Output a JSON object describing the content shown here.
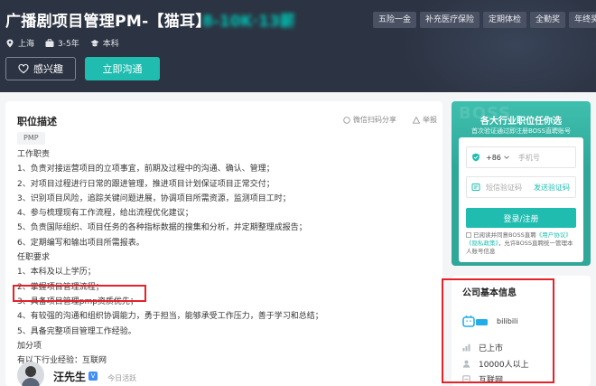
{
  "header": {
    "job_title": "广播剧项目管理PM-【猫耳】",
    "salary": "8-10K·13薪",
    "meta": {
      "city": "上海",
      "experience": "3-5年",
      "education": "本科"
    },
    "benefit_tags": [
      "五险一金",
      "补充医疗保险",
      "定期体检",
      "全勤奖",
      "年终奖"
    ],
    "interest_label": "感兴趣",
    "chat_label": "立即沟通"
  },
  "job": {
    "section_title": "职位描述",
    "share_label": "微信扫码分享",
    "report_label": "举报",
    "skill_tag": "PMP",
    "lines": [
      "工作职责",
      "1、负责对接运营项目的立项事宜，前期及过程中的沟通、确认、管理；",
      "2、对项目过程进行日常的跟进管理，推进项目计划保证项目正常交付；",
      "3、识别项目风险，追踪关键问题进展，协调项目所需资源，监测项目工时；",
      "4、参与梳理现有工作流程，给出流程优化建议；",
      "5、负责国际组织、项目任务的各种指标数据的搜集和分析，并定期整理成报告；",
      "6、定期编写和输出项目所需报表。",
      "任职要求",
      "1、本科及以上学历；",
      "2、掌握项目管理流程；",
      "3、具备项目管理pmp资质优先；",
      "4、有较强的沟通和组织协调能力，勇于担当，能够承受工作压力，善于学习和总结；",
      "5、具备完整项目管理工作经验。",
      "加分项",
      "有以下行业经验：互联网"
    ],
    "recruiter": {
      "name": "汪先生",
      "status": "今日活跃"
    }
  },
  "login": {
    "bg_text": "BOSS",
    "headline": "各大行业职位任你选",
    "subline": "首次验证通过即注册BOSS直聘账号",
    "country_code": "+86",
    "phone_placeholder": "手机号",
    "code_placeholder": "短信验证码",
    "send_code_label": "发送验证码",
    "submit_label": "登录/注册",
    "agree_prefix": "已阅读并同意BOSS直聘",
    "agree_link1": "《用户协议》",
    "agree_link2": "《隐私政策》",
    "agree_suffix": "，允许BOSS直聘统一管理本人账号信息"
  },
  "company": {
    "title": "公司基本信息",
    "name": "bilibili",
    "stage": "已上市",
    "size": "10000人以上",
    "industry": "互联网"
  },
  "colors": {
    "header_bg": "#2c3342",
    "accent": "#1fbcaf",
    "highlight": "#e5222a"
  }
}
